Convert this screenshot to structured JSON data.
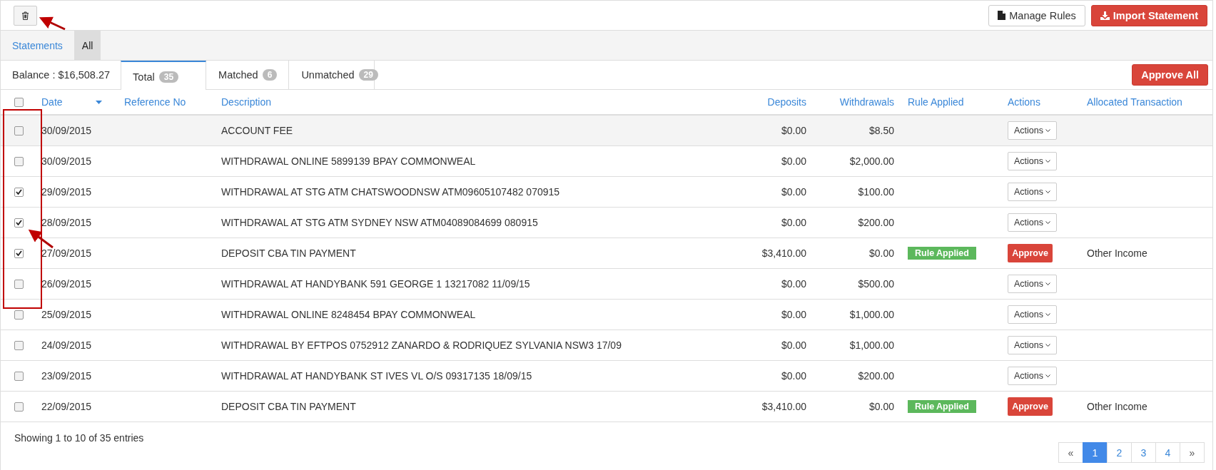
{
  "toolbar": {
    "buttons": [
      {
        "label": "Manage Rules",
        "kind": "default"
      },
      {
        "label": "Import Statement",
        "kind": "danger"
      }
    ]
  },
  "nav": [
    {
      "label": "Statements",
      "selected": false
    },
    {
      "label": "All",
      "selected": true
    }
  ],
  "balance": "Balance : $16,508.27",
  "tabs": [
    {
      "label": "Total",
      "count": "35",
      "selected": true
    },
    {
      "label": "Matched",
      "count": "6",
      "selected": false
    },
    {
      "label": "Unmatched",
      "count": "29",
      "selected": false
    }
  ],
  "approve_all": "Approve All",
  "table": {
    "select_all_checked": false,
    "columns": [
      "Date",
      "Reference No",
      "Description",
      "Deposits",
      "Withdrawals",
      "Rule Applied",
      "Actions",
      "Allocated Transaction"
    ],
    "rows": [
      {
        "checked": false,
        "date": "30/09/2015",
        "description": "ACCOUNT FEE",
        "deposits": "$0.00",
        "withdrawals": "$8.50",
        "action": {
          "kind": "menu",
          "label": "Actions"
        }
      },
      {
        "checked": false,
        "date": "30/09/2015",
        "description": "WITHDRAWAL ONLINE 5899139 BPAY COMMONWEAL",
        "deposits": "$0.00",
        "withdrawals": "$2,000.00",
        "action": {
          "kind": "menu",
          "label": "Actions"
        }
      },
      {
        "checked": true,
        "date": "29/09/2015",
        "description": "WITHDRAWAL AT STG ATM CHATSWOODNSW ATM09605107482 070915",
        "deposits": "$0.00",
        "withdrawals": "$100.00",
        "action": {
          "kind": "menu",
          "label": "Actions"
        }
      },
      {
        "checked": true,
        "date": "28/09/2015",
        "description": "WITHDRAWAL AT STG ATM SYDNEY NSW ATM04089084699 080915",
        "deposits": "$0.00",
        "withdrawals": "$200.00",
        "action": {
          "kind": "menu",
          "label": "Actions"
        }
      },
      {
        "checked": true,
        "date": "27/09/2015",
        "description": "DEPOSIT CBA TIN PAYMENT",
        "deposits": "$3,410.00",
        "withdrawals": "$0.00",
        "rule": "Rule Applied",
        "action": {
          "kind": "approve",
          "label": "Approve"
        },
        "allocated": "Other Income"
      },
      {
        "checked": false,
        "date": "26/09/2015",
        "description": "WITHDRAWAL AT HANDYBANK 591 GEORGE 1 13217082 11/09/15",
        "deposits": "$0.00",
        "withdrawals": "$500.00",
        "action": {
          "kind": "menu",
          "label": "Actions"
        }
      },
      {
        "checked": false,
        "date": "25/09/2015",
        "description": "WITHDRAWAL ONLINE 8248454 BPAY COMMONWEAL",
        "deposits": "$0.00",
        "withdrawals": "$1,000.00",
        "action": {
          "kind": "menu",
          "label": "Actions"
        }
      },
      {
        "checked": false,
        "date": "24/09/2015",
        "description": "WITHDRAWAL BY EFTPOS 0752912 ZANARDO & RODRIQUEZ SYLVANIA NSW3 17/09",
        "deposits": "$0.00",
        "withdrawals": "$1,000.00",
        "action": {
          "kind": "menu",
          "label": "Actions"
        }
      },
      {
        "checked": false,
        "date": "23/09/2015",
        "description": "WITHDRAWAL AT HANDYBANK ST IVES VL O/S 09317135 18/09/15",
        "deposits": "$0.00",
        "withdrawals": "$200.00",
        "action": {
          "kind": "menu",
          "label": "Actions"
        }
      },
      {
        "checked": false,
        "date": "22/09/2015",
        "description": "DEPOSIT CBA TIN PAYMENT",
        "deposits": "$3,410.00",
        "withdrawals": "$0.00",
        "rule": "Rule Applied",
        "action": {
          "kind": "approve",
          "label": "Approve"
        },
        "allocated": "Other Income"
      }
    ]
  },
  "footer": "Showing 1 to 10 of 35 entries",
  "pagination": [
    {
      "label": "«",
      "kind": "prev",
      "selected": false
    },
    {
      "label": "1",
      "kind": "page",
      "selected": true
    },
    {
      "label": "2",
      "kind": "page",
      "selected": false
    },
    {
      "label": "3",
      "kind": "page",
      "selected": false
    },
    {
      "label": "4",
      "kind": "page",
      "selected": false
    },
    {
      "label": "»",
      "kind": "next",
      "selected": false
    }
  ]
}
